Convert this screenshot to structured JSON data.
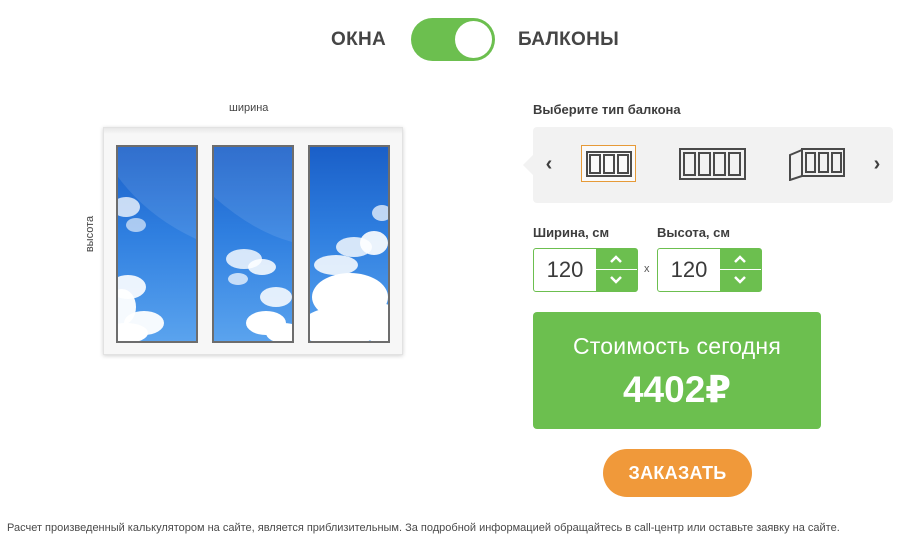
{
  "toggle": {
    "left_label": "ОКНА",
    "right_label": "БАЛКОНЫ",
    "state": "right",
    "color": "#6cbf4f"
  },
  "preview": {
    "width_label": "ширина",
    "height_label": "высота",
    "panes": 3
  },
  "balcony_type": {
    "title": "Выберите тип балкона",
    "prev_icon": "chevron-left-icon",
    "next_icon": "chevron-right-icon",
    "prev_glyph": "‹",
    "next_glyph": "›",
    "options": [
      {
        "icon": "balcony-3-section-icon",
        "selected": true
      },
      {
        "icon": "balcony-4-section-icon",
        "selected": false
      },
      {
        "icon": "balcony-angled-icon",
        "selected": false
      }
    ],
    "selected_border_color": "#e69a38"
  },
  "dimensions": {
    "width_label": "Ширина, см",
    "width_value": "120",
    "height_label": "Высота, см",
    "height_value": "120",
    "separator": "x"
  },
  "price": {
    "label": "Стоимость сегодня",
    "value": "4402₽"
  },
  "order_button": {
    "label": "ЗАКАЗАТЬ",
    "color": "#f0993a"
  },
  "disclaimer": "Расчет произведенный калькулятором на сайте, является приблизительным. За подробной информацией обращайтесь в call-центр или оставьте заявку на сайте."
}
